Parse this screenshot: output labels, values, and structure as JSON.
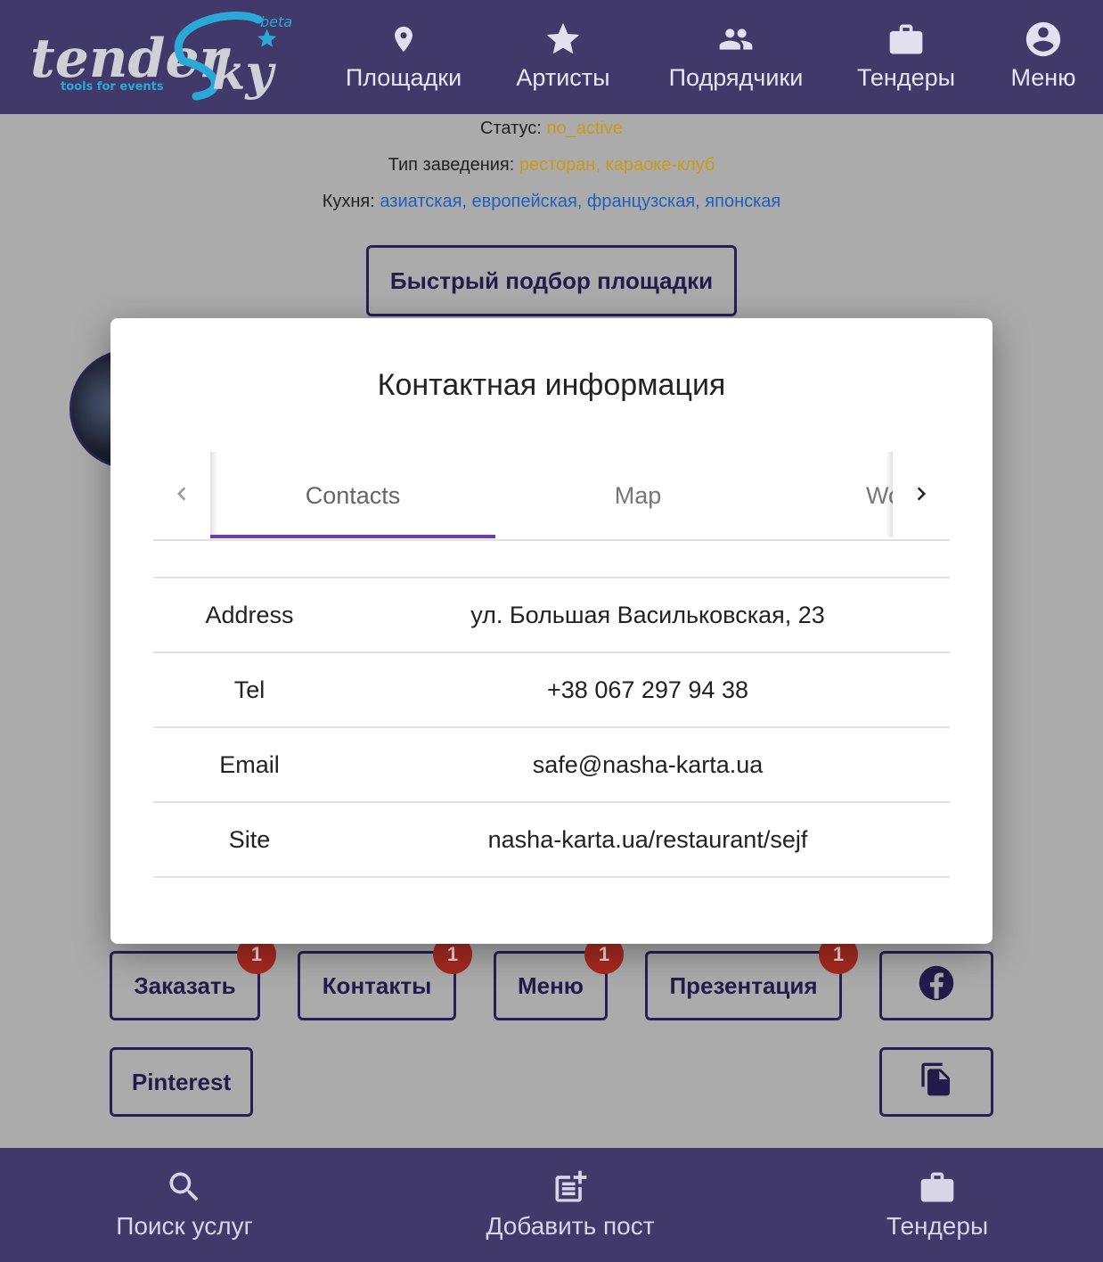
{
  "header": {
    "logo": {
      "word1": "tender",
      "word2": "Sky",
      "tag": "beta",
      "tagline": "tools for events"
    },
    "nav": [
      {
        "label": "Площадки",
        "icon": "location-pin-icon"
      },
      {
        "label": "Артисты",
        "icon": "star-icon"
      },
      {
        "label": "Подрядчики",
        "icon": "people-icon"
      },
      {
        "label": "Тендеры",
        "icon": "briefcase-icon"
      },
      {
        "label": "Меню",
        "icon": "account-circle-icon"
      }
    ]
  },
  "venue": {
    "status_label": "Статус:",
    "status_value": "no_active",
    "type_label": "Тип заведения:",
    "type_value": "ресторан, караоке-клуб",
    "cuisine_label": "Кухня:",
    "cuisine_value": "азиатская, европейская, французская, японская",
    "quick_select_button": "Быстрый подбор площадки"
  },
  "actions": {
    "row1": [
      {
        "label": "Заказать",
        "badge": "1"
      },
      {
        "label": "Контакты",
        "badge": "1"
      },
      {
        "label": "Меню",
        "badge": "1"
      },
      {
        "label": "Презентация",
        "badge": "1"
      }
    ],
    "facebook_icon": "facebook-icon",
    "pinterest": "Pinterest",
    "document_icon": "document-copy-icon"
  },
  "modal": {
    "title": "Контактная информация",
    "tabs": [
      "Contacts",
      "Map",
      "Wo"
    ],
    "active_tab": "Contacts",
    "rows": [
      {
        "key": "Address",
        "value": "ул. Большая Васильковская, 23"
      },
      {
        "key": "Tel",
        "value": "+38 067 297 94 38"
      },
      {
        "key": "Email",
        "value": "safe@nasha-karta.ua"
      },
      {
        "key": "Site",
        "value": "nasha-karta.ua/restaurant/sejf"
      }
    ]
  },
  "bottom_nav": [
    {
      "label": "Поиск услуг",
      "icon": "search-icon"
    },
    {
      "label": "Добавить пост",
      "icon": "add-post-icon"
    },
    {
      "label": "Тендеры",
      "icon": "briefcase-icon"
    }
  ],
  "colors": {
    "header_bg": "#40396a",
    "overlay_bg": "#ababab",
    "accent_tab": "#6a3fb5",
    "status_orange": "#c99a17",
    "link_blue": "#1e5fbf",
    "badge_red": "#a62a21",
    "button_border": "#271f56"
  }
}
